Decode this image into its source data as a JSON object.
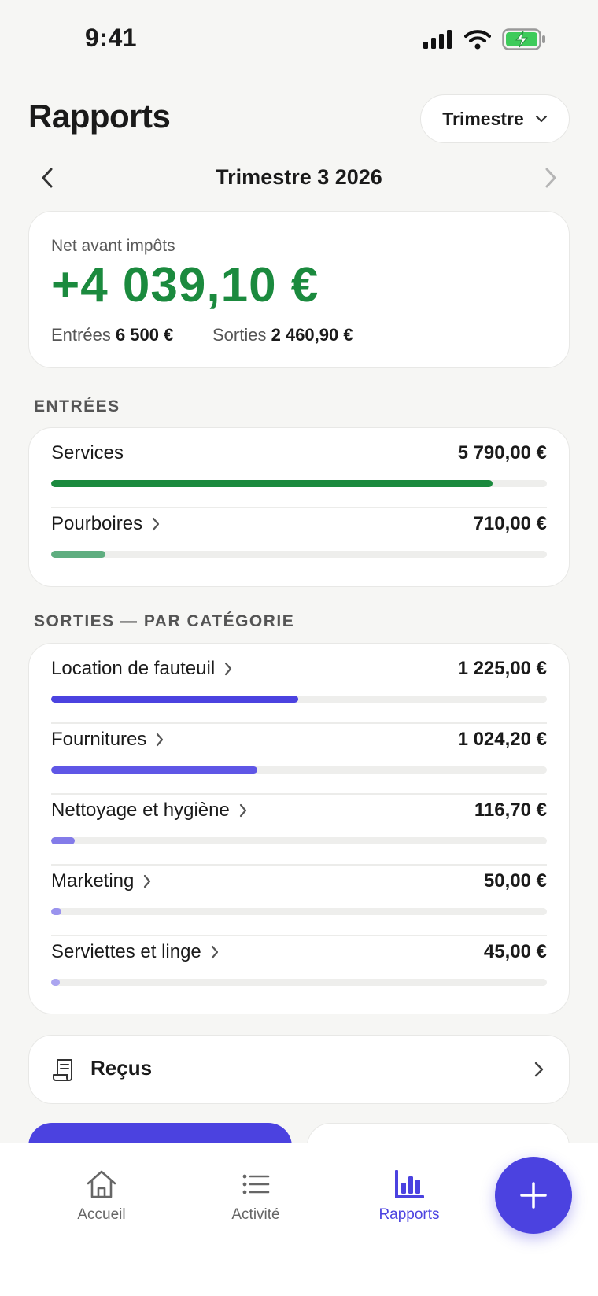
{
  "status_bar": {
    "time": "9:41"
  },
  "header": {
    "title": "Rapports",
    "period_select": "Trimestre"
  },
  "period": {
    "label": "Trimestre 3 2026"
  },
  "summary": {
    "label": "Net avant impôts",
    "value": "+4 039,10 €",
    "income_label": "Entrées",
    "income_value": "6 500 €",
    "expense_label": "Sorties",
    "expense_value": "2 460,90 €"
  },
  "income": {
    "title": "ENTRÉES",
    "items": [
      {
        "label": "Services",
        "value": "5 790,00 €",
        "share": 0.89,
        "color": "#1b8a3e",
        "has_chevron": false
      },
      {
        "label": "Pourboires",
        "value": "710,00 €",
        "share": 0.11,
        "color": "#5fae80",
        "has_chevron": true
      }
    ]
  },
  "expenses": {
    "title": "SORTIES — PAR CATÉGORIE",
    "items": [
      {
        "label": "Location de fauteuil",
        "value": "1 225,00 €",
        "share": 0.498,
        "color": "#4b42e0"
      },
      {
        "label": "Fournitures",
        "value": "1 024,20 €",
        "share": 0.416,
        "color": "#5f56e6"
      },
      {
        "label": "Nettoyage et hygiène",
        "value": "116,70 €",
        "share": 0.047,
        "color": "#837be9"
      },
      {
        "label": "Marketing",
        "value": "50,00 €",
        "share": 0.02,
        "color": "#9a93ee"
      },
      {
        "label": "Serviettes et linge",
        "value": "45,00 €",
        "share": 0.018,
        "color": "#aba5f0"
      }
    ]
  },
  "receipts": {
    "label": "Reçus"
  },
  "tabs": [
    {
      "label": "Accueil",
      "icon": "home-icon",
      "active": false
    },
    {
      "label": "Activité",
      "icon": "list-icon",
      "active": false
    },
    {
      "label": "Rapports",
      "icon": "bar-chart-icon",
      "active": true
    }
  ],
  "colors": {
    "accent": "#4b42e0",
    "positive": "#1b8a3e",
    "background": "#f6f6f4"
  }
}
